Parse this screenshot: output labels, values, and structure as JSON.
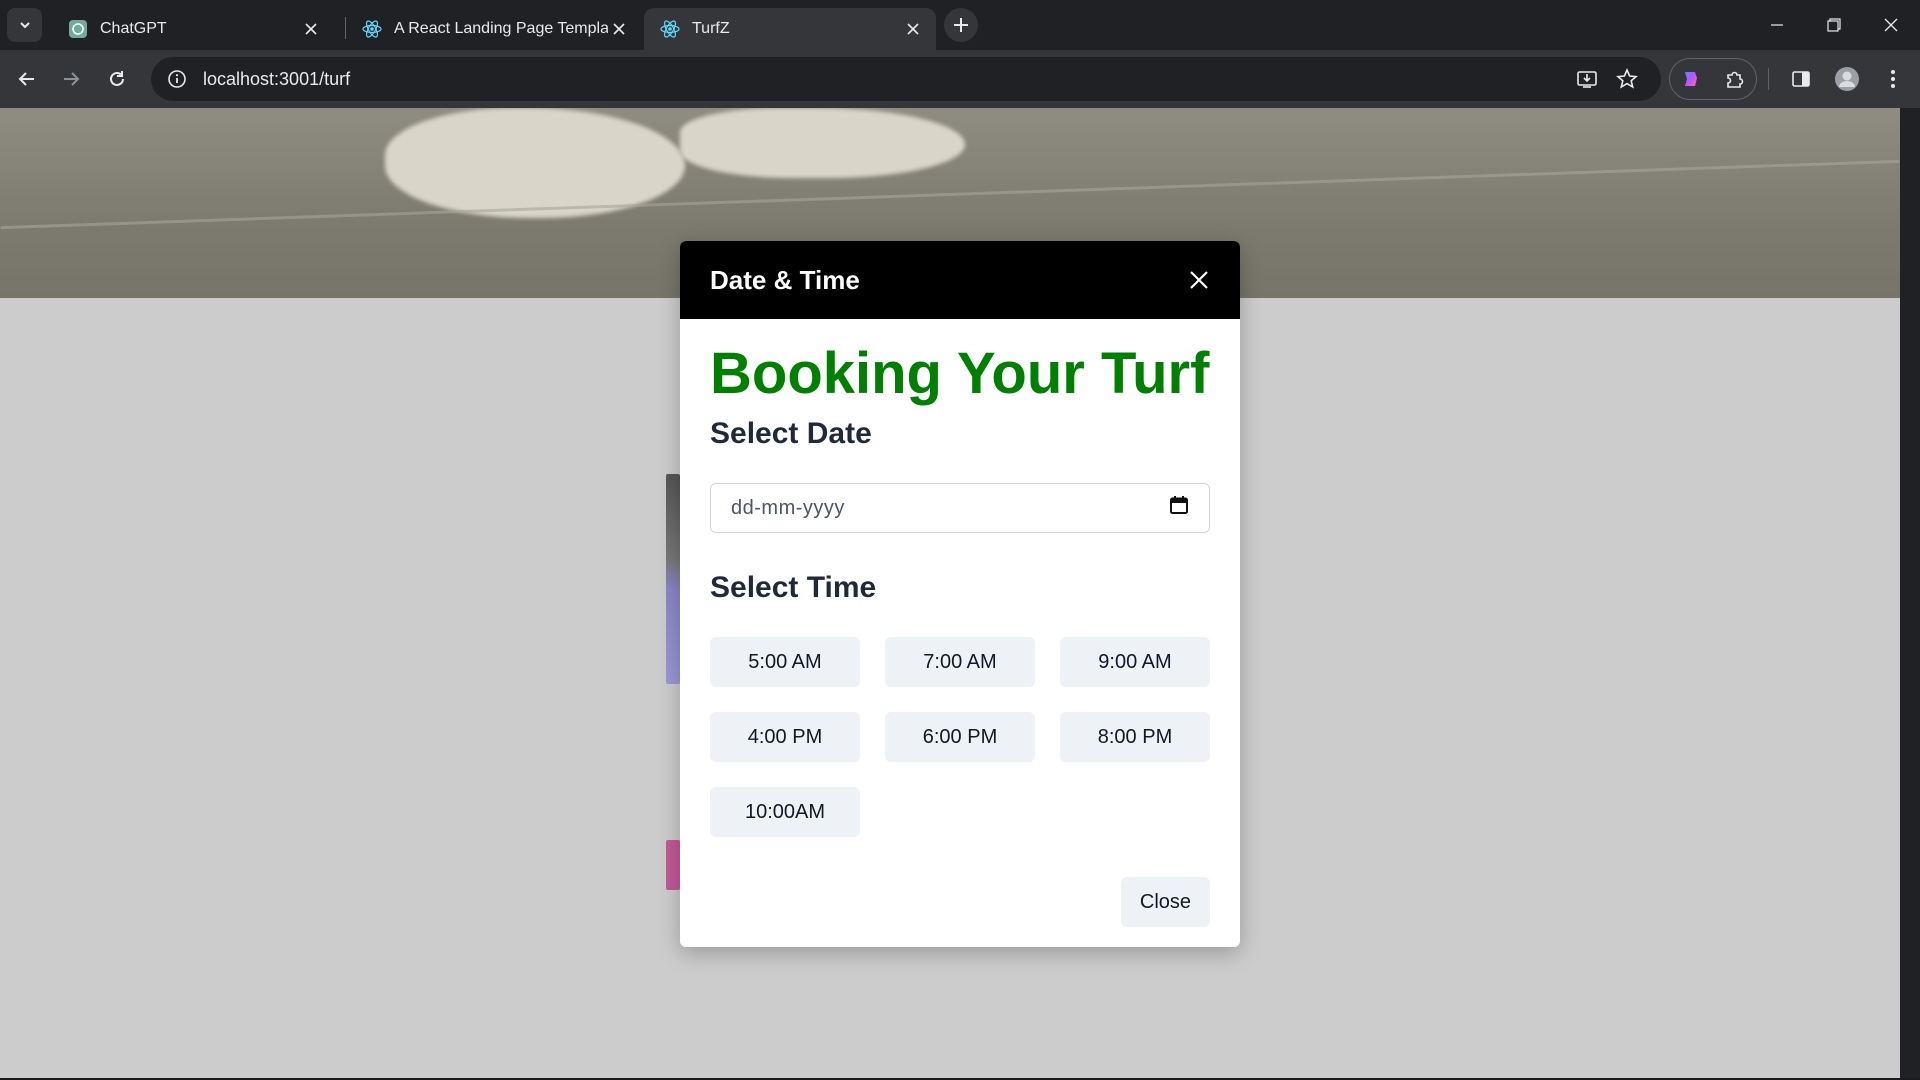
{
  "browser": {
    "tabs": [
      {
        "title": "ChatGPT",
        "icon": "chatgpt-icon",
        "active": false
      },
      {
        "title": "A React Landing Page Template",
        "icon": "react-icon",
        "active": false
      },
      {
        "title": "TurfZ",
        "icon": "react-icon",
        "active": true
      }
    ],
    "url": "localhost:3001/turf",
    "colors": {
      "frame": "#202124",
      "toolbar": "#35363a",
      "text": "#e8eaed"
    }
  },
  "page": {
    "backdrop_color": "#cccccc"
  },
  "modal": {
    "title": "Date & Time",
    "heading": "Booking Your Turf",
    "heading_color": "#008000",
    "select_date_label": "Select Date",
    "date_placeholder": "dd-mm-yyyy",
    "select_time_label": "Select Time",
    "time_slots": [
      "5:00 AM",
      "7:00 AM",
      "9:00 AM",
      "4:00 PM",
      "6:00 PM",
      "8:00 PM",
      "10:00AM"
    ],
    "close_label": "Close"
  }
}
